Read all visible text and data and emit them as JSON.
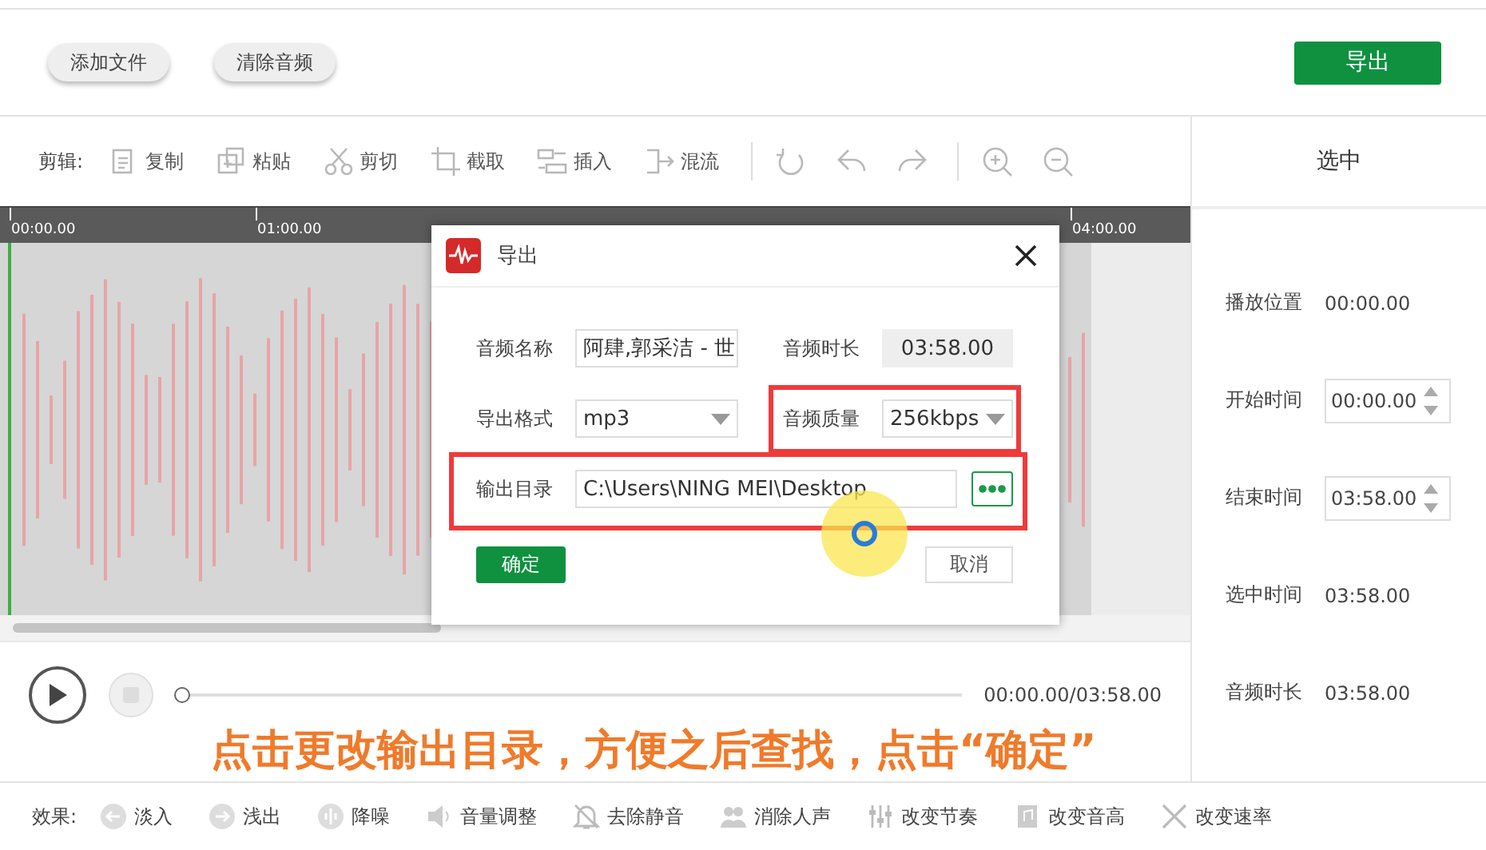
{
  "top_bar": {
    "buttons": [
      "添加文件",
      "清除音频"
    ],
    "export_button": "导出"
  },
  "edit_toolbar": {
    "label": "剪辑:",
    "tools": [
      "复制",
      "粘贴",
      "剪切",
      "截取",
      "插入",
      "混流"
    ]
  },
  "timeline": {
    "ticks": [
      "00:00.00",
      "01:00.00",
      "04:00.00"
    ]
  },
  "player": {
    "time": "00:00.00/03:58.00",
    "level": 0
  },
  "effects": {
    "label": "效果:",
    "items": [
      "淡入",
      "浅出",
      "降噪",
      "音量调整",
      "去除静音",
      "消除人声",
      "改变节奏",
      "改变音高",
      "改变速率"
    ]
  },
  "side_panel": {
    "title": "选中",
    "rows": [
      {
        "label": "播放位置",
        "value": "00:00.00",
        "kind": "text"
      },
      {
        "label": "开始时间",
        "value": "00:00.00",
        "kind": "spinner"
      },
      {
        "label": "结束时间",
        "value": "03:58.00",
        "kind": "spinner"
      },
      {
        "label": "选中时间",
        "value": "03:58.00",
        "kind": "text"
      },
      {
        "label": "音频时长",
        "value": "03:58.00",
        "kind": "text"
      }
    ]
  },
  "dialog": {
    "title": "导出",
    "name": {
      "label": "音频名称",
      "value": "阿肆,郭采洁 - 世"
    },
    "duration": {
      "label": "音频时长",
      "value": "03:58.00"
    },
    "format": {
      "label": "导出格式",
      "value": "mp3"
    },
    "quality": {
      "label": "音频质量",
      "value": "256kbps",
      "highlighted": true
    },
    "output": {
      "label": "输出目录",
      "value": "C:\\Users\\NING MEI\\Desktop",
      "highlighted": true
    },
    "ok_button": "确定",
    "cancel_button": "取消"
  },
  "caption": "点击更改输出目录，方便之后查找，点击“确定”"
}
